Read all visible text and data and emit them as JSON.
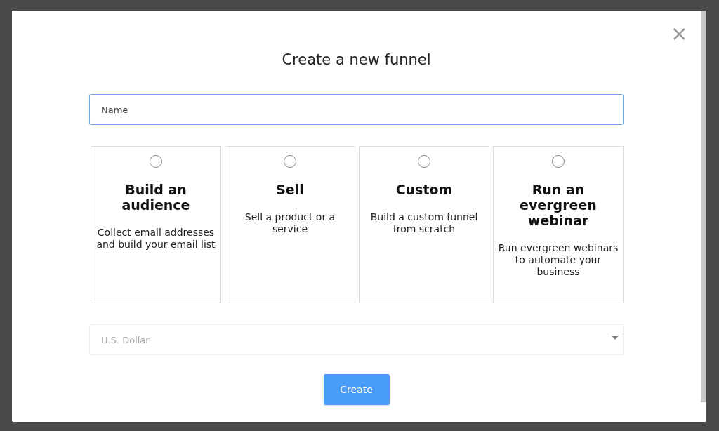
{
  "dialog": {
    "title": "Create a new funnel",
    "close": "×"
  },
  "name_field": {
    "placeholder": "Name"
  },
  "options": [
    {
      "title": "Build an audience",
      "description": "Collect email addresses and build your email list",
      "selected": false
    },
    {
      "title": "Sell",
      "description": "Sell a product or a service",
      "selected": false
    },
    {
      "title": "Custom",
      "description": "Build a custom funnel from scratch",
      "selected": false
    },
    {
      "title": "Run an evergreen webinar",
      "description": "Run evergreen webinars to automate your business",
      "selected": false
    }
  ],
  "currency_select": {
    "value": "U.S. Dollar"
  },
  "buttons": [
    "Create"
  ]
}
